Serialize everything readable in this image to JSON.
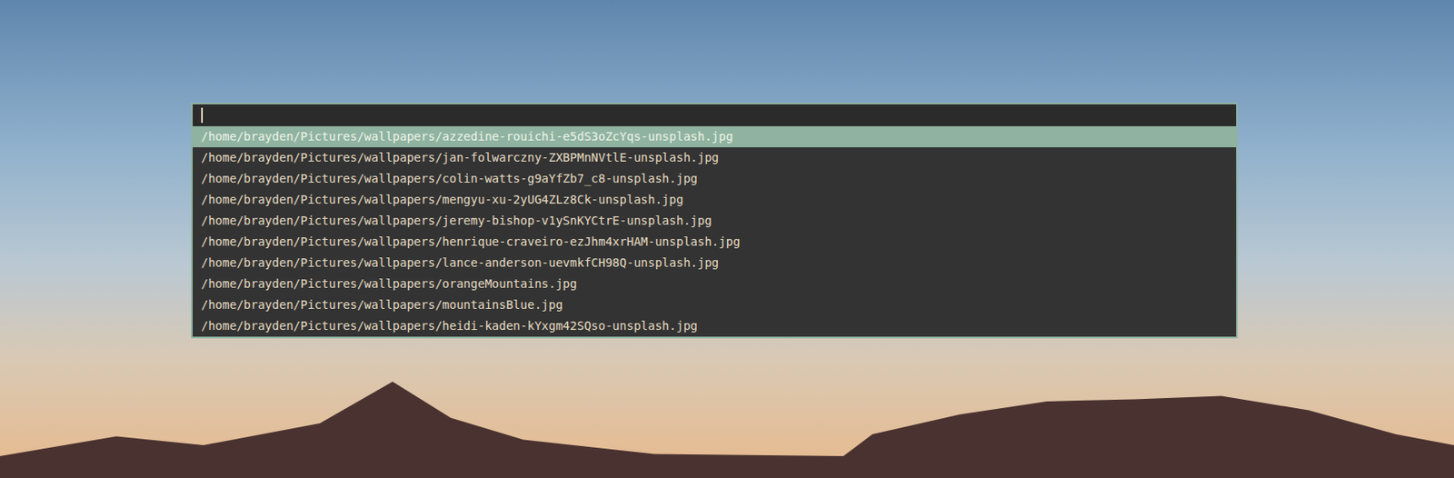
{
  "input": {
    "value": "",
    "focused": true
  },
  "entries": [
    {
      "path": "/home/brayden/Pictures/wallpapers/azzedine-rouichi-e5dS3oZcYqs-unsplash.jpg",
      "selected": true
    },
    {
      "path": "/home/brayden/Pictures/wallpapers/jan-folwarczny-ZXBPMnNVtlE-unsplash.jpg",
      "selected": false
    },
    {
      "path": "/home/brayden/Pictures/wallpapers/colin-watts-g9aYfZb7_c8-unsplash.jpg",
      "selected": false
    },
    {
      "path": "/home/brayden/Pictures/wallpapers/mengyu-xu-2yUG4ZLz8Ck-unsplash.jpg",
      "selected": false
    },
    {
      "path": "/home/brayden/Pictures/wallpapers/jeremy-bishop-v1ySnKYCtrE-unsplash.jpg",
      "selected": false
    },
    {
      "path": "/home/brayden/Pictures/wallpapers/henrique-craveiro-ezJhm4xrHAM-unsplash.jpg",
      "selected": false
    },
    {
      "path": "/home/brayden/Pictures/wallpapers/lance-anderson-uevmkfCH98Q-unsplash.jpg",
      "selected": false
    },
    {
      "path": "/home/brayden/Pictures/wallpapers/orangeMountains.jpg",
      "selected": false
    },
    {
      "path": "/home/brayden/Pictures/wallpapers/mountainsBlue.jpg",
      "selected": false
    },
    {
      "path": "/home/brayden/Pictures/wallpapers/heidi-kaden-kYxgm42SQso-unsplash.jpg",
      "selected": false
    }
  ]
}
